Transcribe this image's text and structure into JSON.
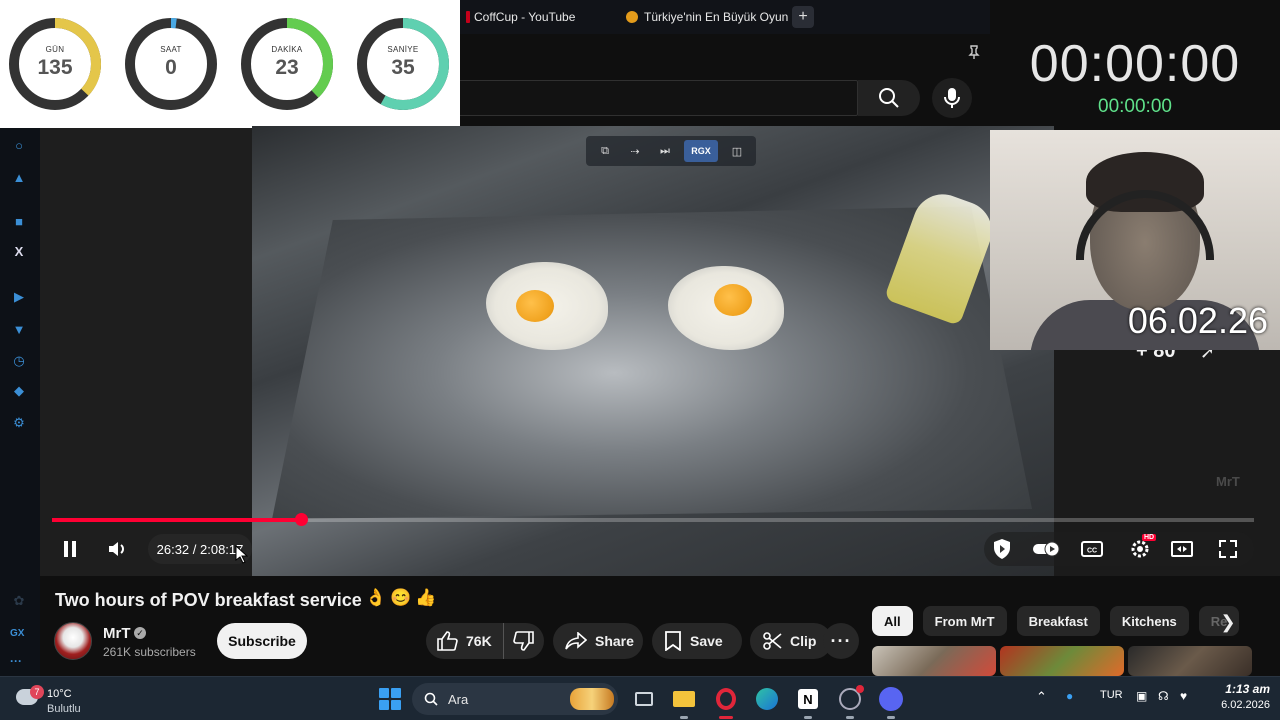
{
  "countdown": {
    "units": [
      {
        "label": "GÜN",
        "value": "135",
        "fraction": 0.37,
        "color": "#e4c64a"
      },
      {
        "label": "SAAT",
        "value": "0",
        "fraction": 0.02,
        "color": "#4aa9e4"
      },
      {
        "label": "DAKİKA",
        "value": "23",
        "fraction": 0.38,
        "color": "#63cc4f"
      },
      {
        "label": "SANİYE",
        "value": "35",
        "fraction": 0.58,
        "color": "#5fd0b0"
      }
    ]
  },
  "browser": {
    "tabs": [
      {
        "title": "CoffCup - YouTube"
      },
      {
        "title": "Türkiye'nin En Büyük Oyun"
      }
    ],
    "new_tab_label": "+"
  },
  "stopwatch": {
    "main": "00:00:00",
    "sub": "00:00:00"
  },
  "webcam": {
    "date": "06.02.26"
  },
  "video": {
    "overlay_count": "+ 80",
    "watermark": "MrT",
    "rgx_label": "RGX",
    "progress": 0.207,
    "time": "26:32 / 2:08:17",
    "hd_badge": "HD"
  },
  "watch": {
    "title": "Two hours of POV breakfast service",
    "emojis": "👌😊👍",
    "channel": "MrT",
    "subscribers": "261K subscribers",
    "subscribe_label": "Subscribe",
    "likes": "76K",
    "share_label": "Share",
    "save_label": "Save",
    "clip_label": "Clip",
    "more_label": "···"
  },
  "chips": [
    {
      "label": "All",
      "active": true
    },
    {
      "label": "From MrT"
    },
    {
      "label": "Breakfast"
    },
    {
      "label": "Kitchens"
    },
    {
      "label": "Re"
    }
  ],
  "sidebar_bottom": {
    "gx": "GX",
    "more": "···"
  },
  "taskbar": {
    "weather_temp": "10°C",
    "weather_desc": "Bulutlu",
    "weather_badge": "7",
    "search_placeholder": "Ara",
    "language": "TUR",
    "time": "1:13 am",
    "date": "6.02.2026"
  }
}
